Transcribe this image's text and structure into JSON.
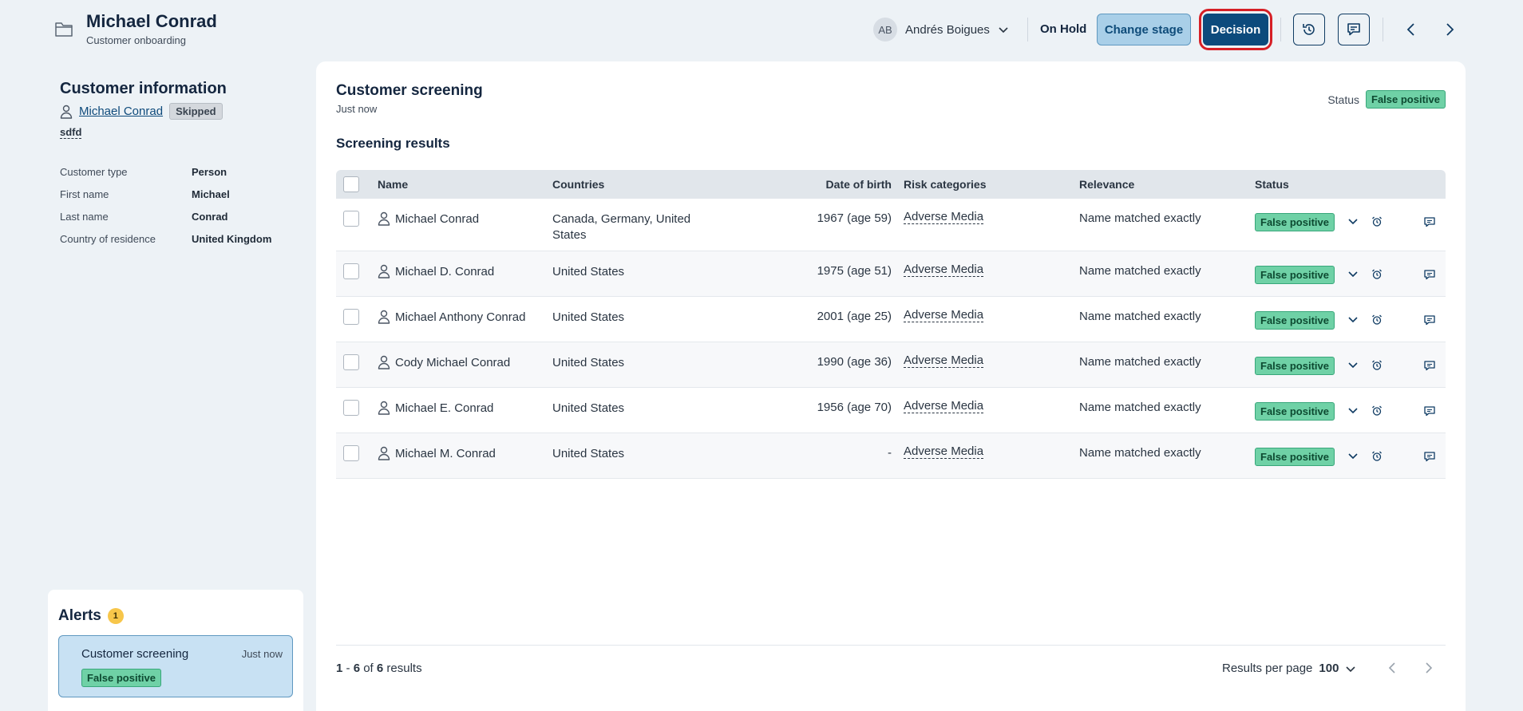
{
  "header": {
    "title": "Michael Conrad",
    "subtitle": "Customer onboarding",
    "assignee_initials": "AB",
    "assignee_name": "Andrés Boigues",
    "stage": "On Hold",
    "change_stage_label": "Change stage",
    "decision_label": "Decision"
  },
  "customer": {
    "heading": "Customer information",
    "name": "Michael Conrad",
    "status": "Skipped",
    "tag": "sdfd",
    "fields": [
      {
        "label": "Customer type",
        "value": "Person"
      },
      {
        "label": "First name",
        "value": "Michael"
      },
      {
        "label": "Last name",
        "value": "Conrad"
      },
      {
        "label": "Country of residence",
        "value": "United Kingdom"
      }
    ]
  },
  "alerts": {
    "title": "Alerts",
    "count": "1",
    "item": {
      "name": "Customer screening",
      "time": "Just now",
      "status": "False positive"
    }
  },
  "screening": {
    "title": "Customer screening",
    "time": "Just now",
    "status_label": "Status",
    "status": "False positive",
    "results_title": "Screening results",
    "columns": {
      "name": "Name",
      "countries": "Countries",
      "dob": "Date of birth",
      "risk": "Risk categories",
      "relevance": "Relevance",
      "status": "Status"
    },
    "rows": [
      {
        "name": "Michael Conrad",
        "countries": "Canada, Germany, United States",
        "dob": "1967 (age 59)",
        "risk": "Adverse Media",
        "relevance": "Name matched exactly",
        "status": "False positive"
      },
      {
        "name": "Michael D. Conrad",
        "countries": "United States",
        "dob": "1975 (age 51)",
        "risk": "Adverse Media",
        "relevance": "Name matched exactly",
        "status": "False positive"
      },
      {
        "name": "Michael Anthony Conrad",
        "countries": "United States",
        "dob": "2001 (age 25)",
        "risk": "Adverse Media",
        "relevance": "Name matched exactly",
        "status": "False positive"
      },
      {
        "name": "Cody Michael Conrad",
        "countries": "United States",
        "dob": "1990 (age 36)",
        "risk": "Adverse Media",
        "relevance": "Name matched exactly",
        "status": "False positive"
      },
      {
        "name": "Michael E. Conrad",
        "countries": "United States",
        "dob": "1956 (age 70)",
        "risk": "Adverse Media",
        "relevance": "Name matched exactly",
        "status": "False positive"
      },
      {
        "name": "Michael M. Conrad",
        "countries": "United States",
        "dob": "-",
        "risk": "Adverse Media",
        "relevance": "Name matched exactly",
        "status": "False positive"
      }
    ],
    "pagination": {
      "range_start": "1",
      "range_end": "6",
      "of_label": "of",
      "total": "6",
      "results_label": "results",
      "per_page_label": "Results per page",
      "per_page": "100"
    }
  },
  "colors": {
    "accent": "#0c4a7c",
    "decision_highlight": "#d61f26",
    "status_green": "#6fd1a6"
  }
}
